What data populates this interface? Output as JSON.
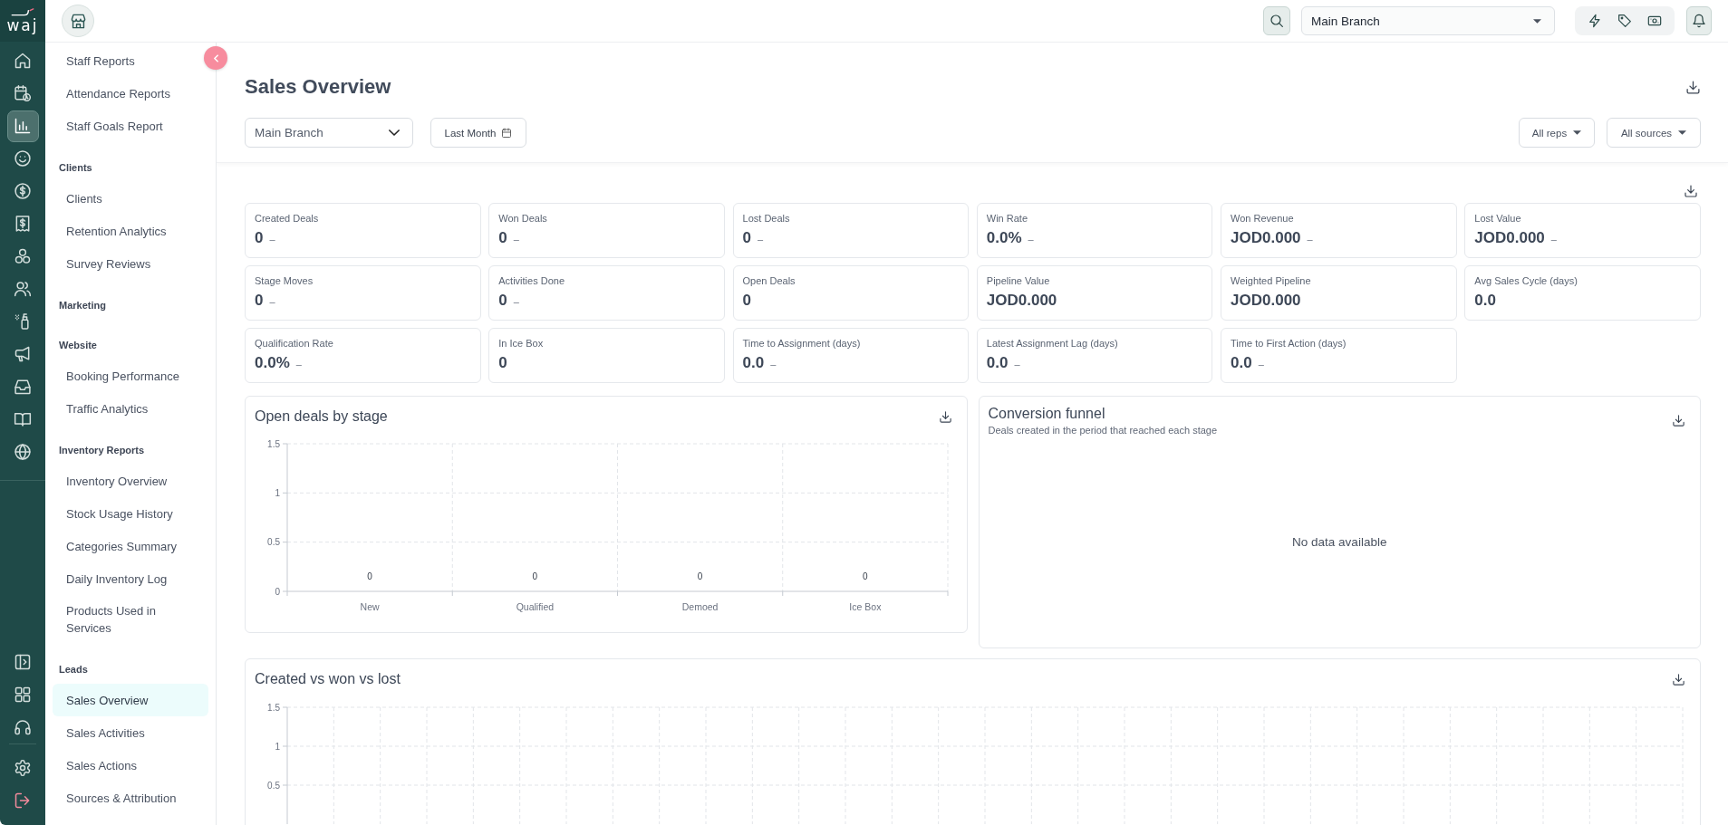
{
  "rail": {
    "logo": "waj",
    "top_items": [
      {
        "selected": false
      },
      {
        "selected": false
      },
      {
        "selected": true
      },
      {
        "selected": false
      },
      {
        "selected": false
      },
      {
        "selected": false
      },
      {
        "selected": false
      },
      {
        "selected": false
      },
      {
        "selected": false
      },
      {
        "selected": false
      },
      {
        "selected": false
      },
      {
        "selected": false
      },
      {
        "selected": false
      }
    ],
    "bottom_items": [
      {
        "selected": false
      },
      {
        "selected": false
      },
      {
        "selected": false
      },
      {
        "selected": false
      },
      {
        "selected": false
      }
    ]
  },
  "topbar": {
    "branch_select": {
      "value": "Main Branch"
    }
  },
  "sidebar": {
    "sections": [
      {
        "items": [
          {
            "label": "Staff Reports",
            "selected": false
          },
          {
            "label": "Attendance Reports",
            "selected": false
          },
          {
            "label": "Staff Goals Report",
            "selected": false
          }
        ]
      },
      {
        "heading": "Clients",
        "items": [
          {
            "label": "Clients",
            "selected": false
          },
          {
            "label": "Retention Analytics",
            "selected": false
          },
          {
            "label": "Survey Reviews",
            "selected": false
          }
        ]
      },
      {
        "heading": "Marketing"
      },
      {
        "heading": "Website",
        "items": [
          {
            "label": "Booking Performance",
            "selected": false
          },
          {
            "label": "Traffic Analytics",
            "selected": false
          }
        ]
      },
      {
        "heading": "Inventory Reports",
        "items": [
          {
            "label": "Inventory Overview",
            "selected": false
          },
          {
            "label": "Stock Usage History",
            "selected": false
          },
          {
            "label": "Categories Summary",
            "selected": false
          },
          {
            "label": "Daily Inventory Log",
            "selected": false
          },
          {
            "label": "Products Used in Services",
            "selected": false
          }
        ]
      },
      {
        "heading": "Leads",
        "items": [
          {
            "label": "Sales Overview",
            "selected": true
          },
          {
            "label": "Sales Activities",
            "selected": false
          },
          {
            "label": "Sales Actions",
            "selected": false
          },
          {
            "label": "Sources & Attribution",
            "selected": false
          }
        ]
      }
    ]
  },
  "page": {
    "title": "Sales Overview",
    "filters": {
      "branch": "Main Branch",
      "period": "Last Month",
      "reps": "All reps",
      "sources": "All sources"
    }
  },
  "kpis": [
    {
      "label": "Created Deals",
      "value": "0",
      "trend": "–"
    },
    {
      "label": "Won Deals",
      "value": "0",
      "trend": "–"
    },
    {
      "label": "Lost Deals",
      "value": "0",
      "trend": "–"
    },
    {
      "label": "Win Rate",
      "value": "0.0%",
      "trend": "–"
    },
    {
      "label": "Won Revenue",
      "value": "JOD0.000",
      "trend": "–"
    },
    {
      "label": "Lost Value",
      "value": "JOD0.000",
      "trend": "–"
    },
    {
      "label": "Stage Moves",
      "value": "0",
      "trend": "–"
    },
    {
      "label": "Activities Done",
      "value": "0",
      "trend": "–"
    },
    {
      "label": "Open Deals",
      "value": "0"
    },
    {
      "label": "Pipeline Value",
      "value": "JOD0.000"
    },
    {
      "label": "Weighted Pipeline",
      "value": "JOD0.000"
    },
    {
      "label": "Avg Sales Cycle (days)",
      "value": "0.0"
    },
    {
      "label": "Qualification Rate",
      "value": "0.0%",
      "trend": "–"
    },
    {
      "label": "In Ice Box",
      "value": "0"
    },
    {
      "label": "Time to Assignment (days)",
      "value": "0.0",
      "trend": "–"
    },
    {
      "label": "Latest Assignment Lag (days)",
      "value": "0.0",
      "trend": "–"
    },
    {
      "label": "Time to First Action (days)",
      "value": "0.0",
      "trend": "–"
    }
  ],
  "open_deals_by_stage": {
    "chart_data": {
      "type": "bar",
      "title": "Open deals by stage",
      "categories": [
        "New",
        "Qualified",
        "Demoed",
        "Ice Box"
      ],
      "values": [
        0,
        0,
        0,
        0
      ],
      "ylim": [
        0,
        1.5
      ],
      "yticks": [
        0,
        0.5,
        1,
        1.5
      ],
      "data_labels": true
    }
  },
  "conversion_funnel": {
    "title": "Conversion funnel",
    "subtitle": "Deals created in the period that reached each stage",
    "empty_message": "No data available"
  },
  "created_won_lost": {
    "chart_data": {
      "type": "bar",
      "title": "Created vs won vs lost",
      "categories": [
        null,
        null,
        null,
        null,
        null,
        null,
        null,
        null,
        null,
        null,
        null,
        null,
        null,
        null,
        null,
        null,
        null,
        null,
        null,
        null,
        null,
        null,
        null,
        null,
        null,
        null,
        null,
        null,
        null,
        null
      ],
      "ylim": [
        0,
        1.5
      ],
      "yticks": [
        0.5,
        1,
        1.5
      ]
    }
  }
}
